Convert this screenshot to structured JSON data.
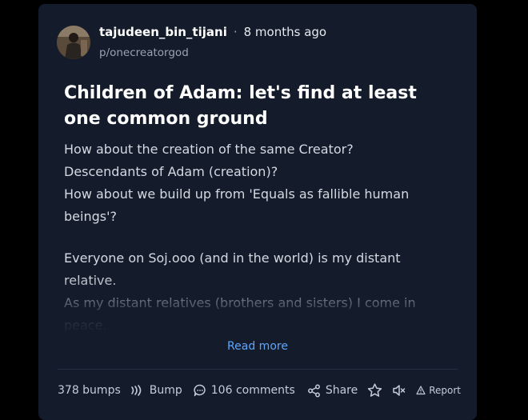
{
  "post": {
    "author": "tajudeen_bin_tijani",
    "separator": "·",
    "time": "8 months ago",
    "community": "p/onecreatorgod",
    "title": "Children of Adam: let's find at least one common ground",
    "body": {
      "line1": "How about the creation of the same Creator?",
      "line2": "Descendants of Adam (creation)?",
      "line3": "How about we build up from 'Equals as fallible human beings'?",
      "para2": "Everyone on Soj.ooo (and in the world) is my distant relative.",
      "para3": "As my distant relatives (brothers and sisters) I come in peace."
    },
    "read_more": "Read more"
  },
  "footer": {
    "bumps": "378 bumps",
    "bump_label": "Bump",
    "comments": "106 comments",
    "share": "Share",
    "report": "Report"
  },
  "colors": {
    "card_bg": "#141c2b",
    "link": "#60a5fa"
  }
}
